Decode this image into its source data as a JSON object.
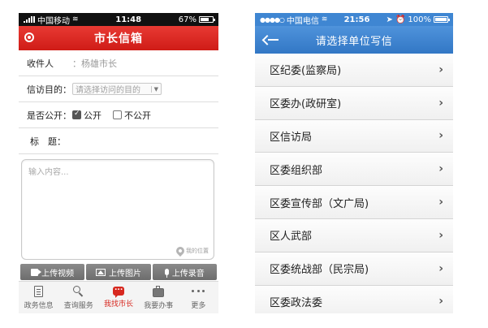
{
  "left": {
    "status": {
      "carrier": "中国移动",
      "time": "11:48",
      "battery": "67%"
    },
    "header": {
      "title": "市长信箱"
    },
    "form": {
      "recipient_label": "收件人",
      "recipient_value": "：杨雄市长",
      "purpose_label": "信访目的：",
      "purpose_placeholder": "请选择访问的目的",
      "public_label": "是否公开：",
      "public_yes": "公开",
      "public_no": "不公开",
      "subject_label": "标　题：",
      "content_placeholder": "输入内容...",
      "location_label": "我的位置"
    },
    "upload": {
      "video": "上传视频",
      "image": "上传图片",
      "audio": "上传录音"
    },
    "tabs": [
      {
        "label": "政务信息",
        "icon": "document-icon"
      },
      {
        "label": "查询服务",
        "icon": "search-icon"
      },
      {
        "label": "我找市长",
        "icon": "chat-icon"
      },
      {
        "label": "我要办事",
        "icon": "briefcase-icon"
      },
      {
        "label": "更多",
        "icon": "more-icon"
      }
    ],
    "colors": {
      "accent": "#d7281f",
      "header": "#e02a24"
    }
  },
  "right": {
    "status": {
      "carrier": "中国电信",
      "time": "21:56",
      "battery": "100%"
    },
    "header": {
      "title": "请选择单位写信"
    },
    "departments": [
      "区纪委(监察局)",
      "区委办(政研室)",
      "区信访局",
      "区委组织部",
      "区委宣传部（文广局)",
      "区人武部",
      "区委统战部（民宗局)",
      "区委政法委"
    ],
    "colors": {
      "header": "#3f86d2"
    }
  }
}
